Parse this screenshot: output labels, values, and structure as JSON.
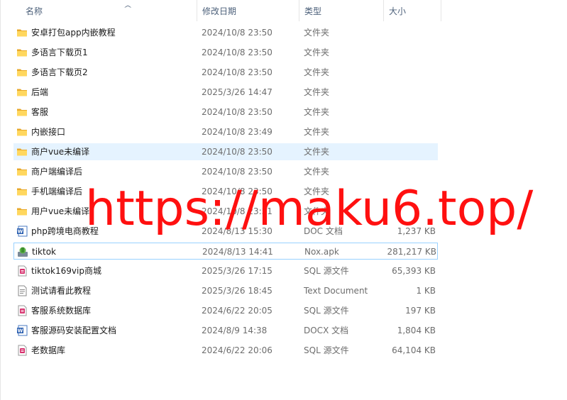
{
  "columns": {
    "name": "名称",
    "date": "修改日期",
    "type": "类型",
    "size": "大小"
  },
  "files": [
    {
      "name": "安卓打包app内嵌教程",
      "date": "2024/10/8 23:50",
      "type": "文件夹",
      "size": "",
      "icon": "folder-icon"
    },
    {
      "name": "多语言下载页1",
      "date": "2024/10/8 23:50",
      "type": "文件夹",
      "size": "",
      "icon": "folder-icon"
    },
    {
      "name": "多语言下载页2",
      "date": "2024/10/8 23:50",
      "type": "文件夹",
      "size": "",
      "icon": "folder-icon"
    },
    {
      "name": "后端",
      "date": "2025/3/26 14:47",
      "type": "文件夹",
      "size": "",
      "icon": "folder-icon"
    },
    {
      "name": "客服",
      "date": "2024/10/8 23:50",
      "type": "文件夹",
      "size": "",
      "icon": "folder-icon"
    },
    {
      "name": "内嵌接口",
      "date": "2024/10/8 23:49",
      "type": "文件夹",
      "size": "",
      "icon": "folder-icon"
    },
    {
      "name": "商户vue未编译",
      "date": "2024/10/8 23:50",
      "type": "文件夹",
      "size": "",
      "icon": "folder-icon"
    },
    {
      "name": "商户端编译后",
      "date": "2024/10/8 23:50",
      "type": "文件夹",
      "size": "",
      "icon": "folder-icon"
    },
    {
      "name": "手机端编译后",
      "date": "2024/10/8 23:50",
      "type": "文件夹",
      "size": "",
      "icon": "folder-icon"
    },
    {
      "name": "用户vue未编译",
      "date": "2024/10/8 23:51",
      "type": "文件夹",
      "size": "",
      "icon": "folder-icon"
    },
    {
      "name": "php跨境电商教程",
      "date": "2024/8/13 15:30",
      "type": "DOC 文档",
      "size": "1,237 KB",
      "icon": "word-doc-icon"
    },
    {
      "name": "tiktok",
      "date": "2024/8/13 14:41",
      "type": "Nox.apk",
      "size": "281,217 KB",
      "icon": "apk-icon"
    },
    {
      "name": "tiktok169vip商城",
      "date": "2025/3/26 17:15",
      "type": "SQL 源文件",
      "size": "65,393 KB",
      "icon": "sql-file-icon"
    },
    {
      "name": "测试请看此教程",
      "date": "2025/3/26 18:45",
      "type": "Text Document",
      "size": "1 KB",
      "icon": "text-file-icon"
    },
    {
      "name": "客服系统数据库",
      "date": "2024/6/22 20:05",
      "type": "SQL 源文件",
      "size": "197 KB",
      "icon": "sql-file-icon"
    },
    {
      "name": "客服源码安装配置文档",
      "date": "2024/8/9 14:38",
      "type": "DOCX 文档",
      "size": "1,804 KB",
      "icon": "word-doc-icon"
    },
    {
      "name": "老数据库",
      "date": "2024/6/22 20:06",
      "type": "SQL 源文件",
      "size": "64,104 KB",
      "icon": "sql-file-icon"
    }
  ],
  "hover_row": 6,
  "focus_row": 11,
  "watermark": "https://maku6.top/"
}
